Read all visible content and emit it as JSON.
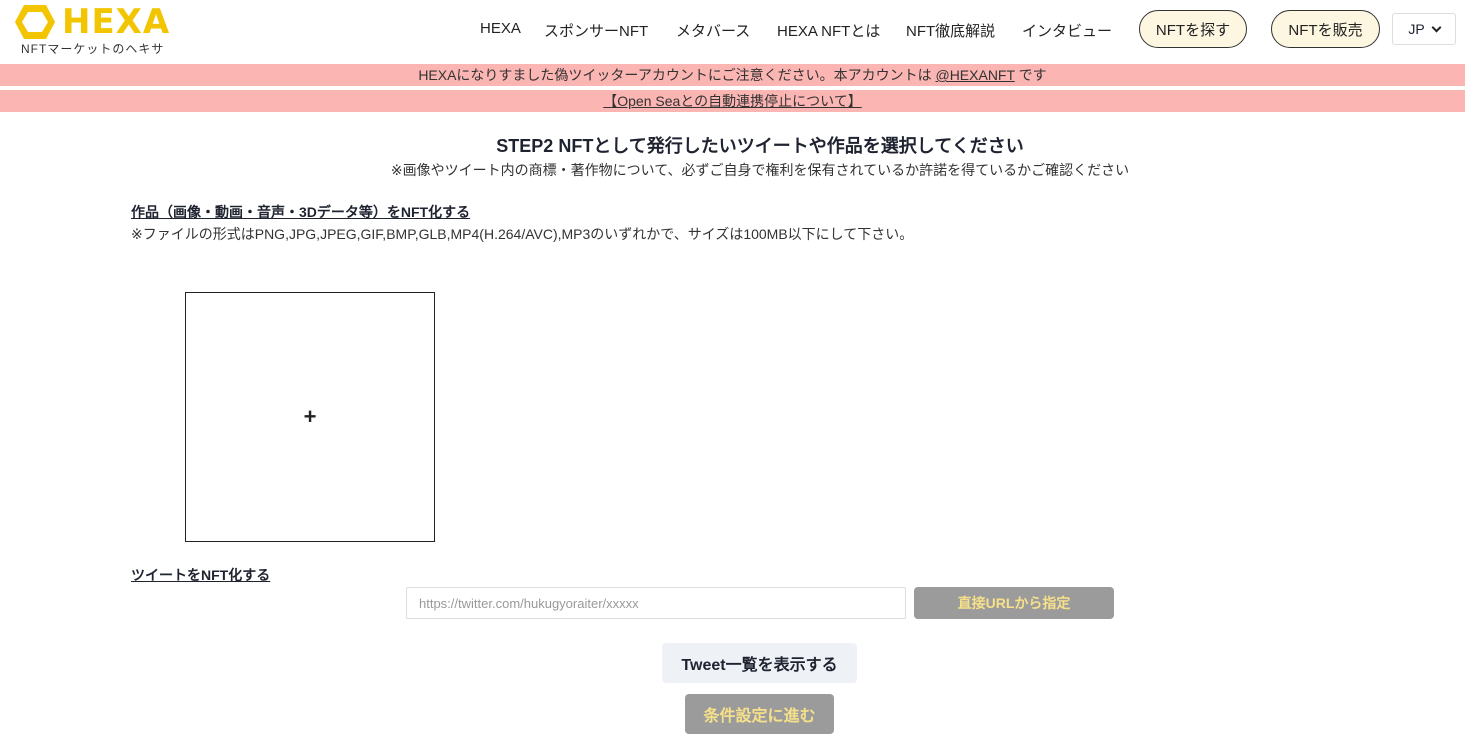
{
  "brand": {
    "name": "HEXA",
    "tagline": "NFTマーケットのヘキサ",
    "color": "#f2c500"
  },
  "nav": {
    "items": [
      "HEXA",
      "スポンサーNFT",
      "メタバース",
      "HEXA NFTとは",
      "NFT徹底解説",
      "インタビュー"
    ],
    "find_button": "NFTを探す",
    "sell_button": "NFTを販売",
    "language": "JP"
  },
  "notices": {
    "warning_text": "HEXAになりすました偽ツイッターアカウントにご注意ください。本アカウントは ",
    "warning_link": "@HEXANFT",
    "warning_suffix": " です",
    "opensea_link": "【Open Seaとの自動連携停止について】",
    "color": "#fbb5b3"
  },
  "step": {
    "title": "STEP2 NFTとして発行したいツイートや作品を選択してください",
    "subtitle": "※画像やツイート内の商標・著作物について、必ずご自身で権利を保有されているか許諾を得ているかご確認ください"
  },
  "artwork": {
    "title": "作品（画像・動画・音声・3Dデータ等）をNFT化する",
    "note": "※ファイルの形式はPNG,JPG,JPEG,GIF,BMP,GLB,MP4(H.264/AVC),MP3のいずれかで、サイズは100MB以下にして下さい。",
    "upload_symbol": "+"
  },
  "tweet": {
    "title": "ツイートをNFT化する",
    "url_placeholder": "https://twitter.com/hukugyoraiter/xxxxx",
    "url_value": "",
    "url_button": "直接URLから指定",
    "list_button": "Tweet一覧を表示する"
  },
  "next_button": "条件設定に進む"
}
